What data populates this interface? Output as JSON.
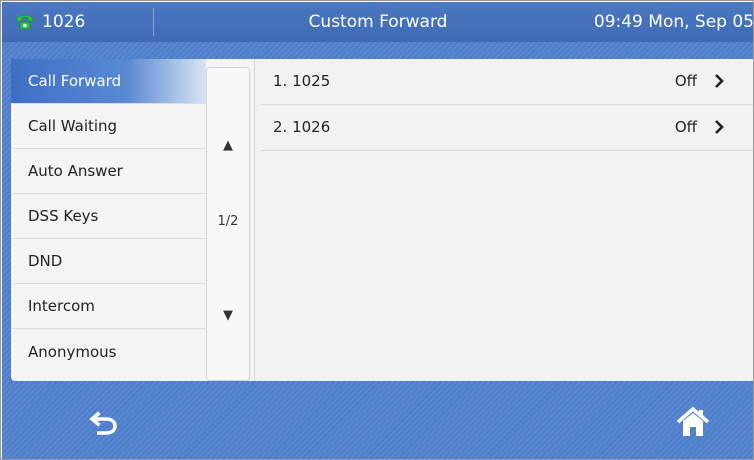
{
  "status_bar": {
    "line_label": "1026",
    "title": "Custom Forward",
    "clock": "09:49 Mon, Sep 05",
    "phone_icon": "phone-handset-icon",
    "accent_color": "#3f6bb4"
  },
  "menu": {
    "items": [
      {
        "label": "Call Forward",
        "active": true
      },
      {
        "label": "Call Waiting",
        "active": false
      },
      {
        "label": "Auto Answer",
        "active": false
      },
      {
        "label": "DSS Keys",
        "active": false
      },
      {
        "label": "DND",
        "active": false
      },
      {
        "label": "Intercom",
        "active": false
      },
      {
        "label": "Anonymous",
        "active": false
      }
    ],
    "page_indicator": "1/2",
    "up_arrow": "▲",
    "down_arrow": "▼"
  },
  "content": {
    "rows": [
      {
        "label": "1. 1025",
        "status": "Off",
        "icon": "chevron-right-icon"
      },
      {
        "label": "2. 1026",
        "status": "Off",
        "icon": "chevron-right-icon"
      }
    ]
  },
  "softkeys": {
    "back_icon": "back-arrow-icon",
    "home_icon": "home-icon"
  }
}
